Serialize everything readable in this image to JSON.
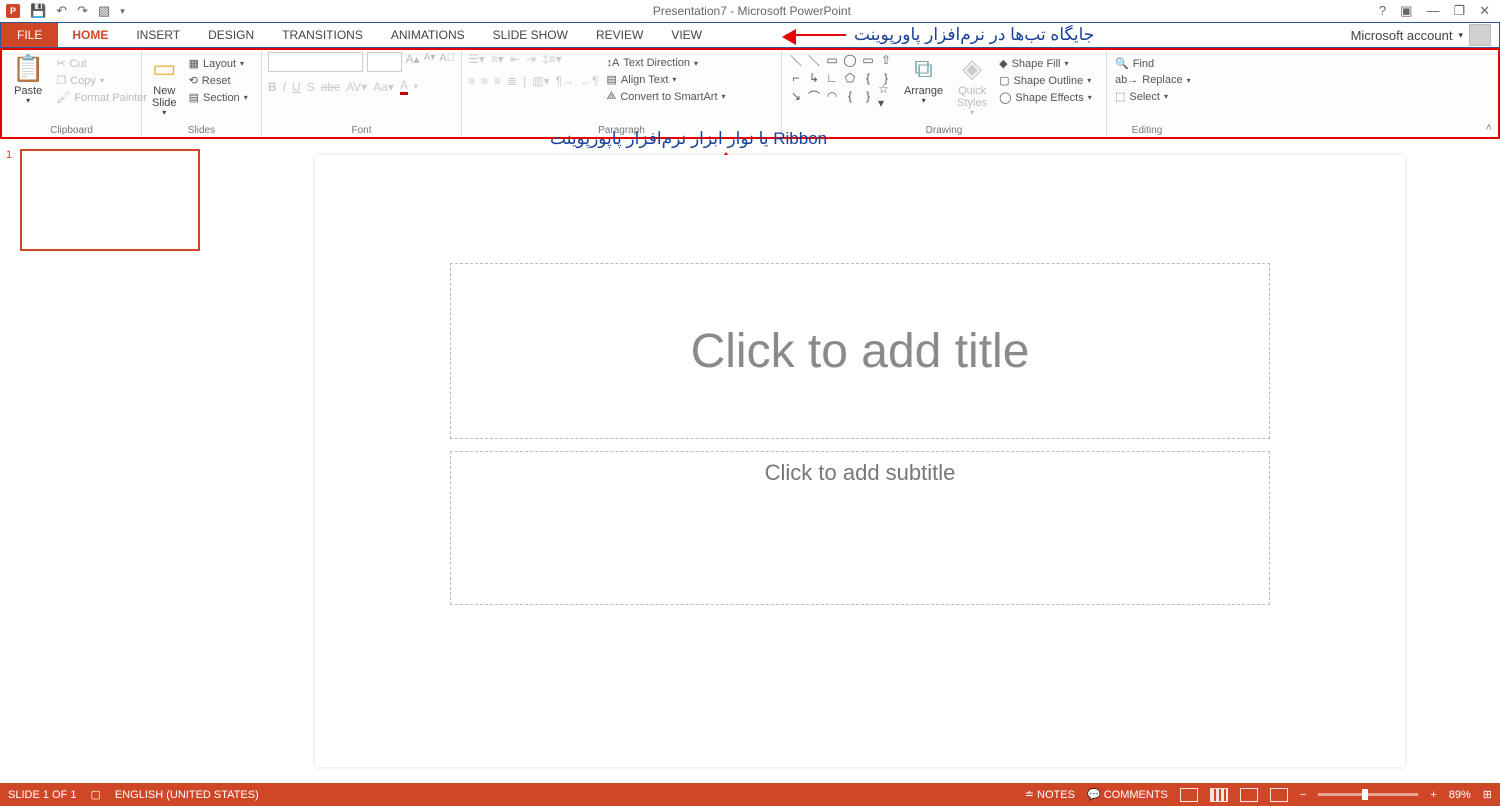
{
  "title": "Presentation7 - Microsoft PowerPoint",
  "account": "Microsoft account",
  "tabs": [
    "FILE",
    "HOME",
    "INSERT",
    "DESIGN",
    "TRANSITIONS",
    "ANIMATIONS",
    "SLIDE SHOW",
    "REVIEW",
    "VIEW"
  ],
  "annotation_tabs": "جایگاه تب‌ها در نرم‌افزار پاورپوینت",
  "annotation_ribbon": "Ribbon  یا نوار ابزار نرم‌افزار پاپورپوینت",
  "ribbon": {
    "clipboard": {
      "label": "Clipboard",
      "paste": "Paste",
      "cut": "Cut",
      "copy": "Copy",
      "fp": "Format Painter"
    },
    "slides": {
      "label": "Slides",
      "new": "New\nSlide",
      "layout": "Layout",
      "reset": "Reset",
      "section": "Section"
    },
    "font": {
      "label": "Font"
    },
    "paragraph": {
      "label": "Paragraph",
      "td": "Text Direction",
      "at": "Align Text",
      "cs": "Convert to SmartArt"
    },
    "drawing": {
      "label": "Drawing",
      "arrange": "Arrange",
      "quick": "Quick\nStyles",
      "sf": "Shape Fill",
      "so": "Shape Outline",
      "se": "Shape Effects"
    },
    "editing": {
      "label": "Editing",
      "find": "Find",
      "replace": "Replace",
      "select": "Select"
    }
  },
  "slide": {
    "num": "1",
    "title_ph": "Click to add title",
    "sub_ph": "Click to add subtitle"
  },
  "status": {
    "slide": "SLIDE 1 OF 1",
    "lang": "ENGLISH (UNITED STATES)",
    "notes": "NOTES",
    "comments": "COMMENTS",
    "zoom": "89%"
  }
}
